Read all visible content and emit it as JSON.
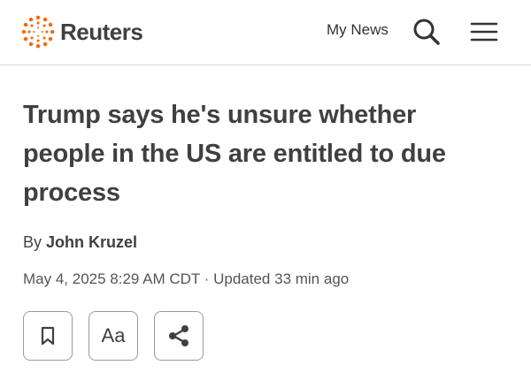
{
  "header": {
    "brand": "Reuters",
    "brand_color": "#fa6400",
    "nav_link": "My News",
    "search_icon": "search-icon",
    "menu_icon": "hamburger-menu-icon"
  },
  "article": {
    "headline": "Trump says he's unsure whether people in the US are entitled to due process",
    "byline_prefix": "By",
    "author": "John Kruzel",
    "dateline": "May 4, 2025 8:29 AM CDT · Updated 33 min ago"
  },
  "actions": {
    "bookmark_icon": "bookmark-icon",
    "text_size_label": "Aa",
    "share_icon": "share-icon"
  }
}
